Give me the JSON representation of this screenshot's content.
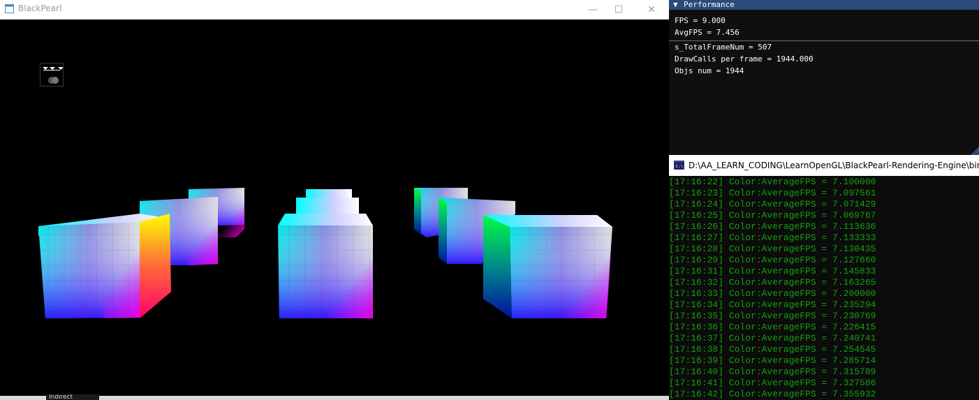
{
  "window": {
    "title": "BlackPearl",
    "min_glyph": "—",
    "max_glyph": "☐",
    "close_glyph": "✕",
    "taskbar_label": "Indirect"
  },
  "performance": {
    "arrow": "▼",
    "title": "Performance",
    "fps": "FPS = 9.000",
    "avg_fps": "AvgFPS = 7.456",
    "total_frames": "s_TotalFrameNum = 507",
    "drawcalls": "DrawCalls per frame = 1944.000",
    "objs": "Objs num = 1944"
  },
  "console": {
    "title": "D:\\AA_LEARN_CODING\\LearnOpenGL\\BlackPearl-Rendering-Engine\\bin\\",
    "lines": [
      "[17:16:22] Color:AverageFPS = 7.100000",
      "[17:16:23] Color:AverageFPS = 7.097561",
      "[17:16:24] Color:AverageFPS = 7.071429",
      "[17:16:25] Color:AverageFPS = 7.069767",
      "[17:16:26] Color:AverageFPS = 7.113636",
      "[17:16:27] Color:AverageFPS = 7.133333",
      "[17:16:28] Color:AverageFPS = 7.130435",
      "[17:16:29] Color:AverageFPS = 7.127660",
      "[17:16:31] Color:AverageFPS = 7.145833",
      "[17:16:32] Color:AverageFPS = 7.163265",
      "[17:16:33] Color:AverageFPS = 7.200000",
      "[17:16:34] Color:AverageFPS = 7.235294",
      "[17:16:35] Color:AverageFPS = 7.230769",
      "[17:16:36] Color:AverageFPS = 7.226415",
      "[17:16:37] Color:AverageFPS = 7.240741",
      "[17:16:38] Color:AverageFPS = 7.254545",
      "[17:16:39] Color:AverageFPS = 7.285714",
      "[17:16:40] Color:AverageFPS = 7.315789",
      "[17:16:41] Color:AverageFPS = 7.327586",
      "[17:16:42] Color:AverageFPS = 7.355932"
    ]
  },
  "colors": {
    "console_text": "#13a10e",
    "panel_header": "#294a7a"
  }
}
